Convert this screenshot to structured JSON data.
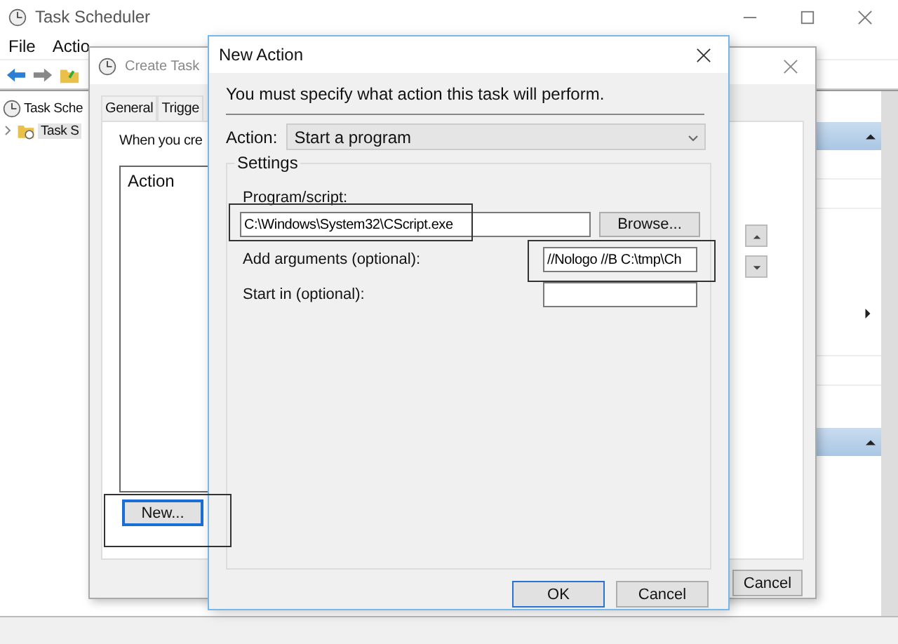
{
  "main_window": {
    "title": "Task Scheduler",
    "menu": [
      "File",
      "Actio"
    ],
    "tree": [
      {
        "label": "Task Sche",
        "expanded": true,
        "children": [
          {
            "label": "Task S",
            "selected": true
          }
        ]
      }
    ]
  },
  "create_task": {
    "title": "Create Task",
    "tabs": [
      {
        "label": "General",
        "selected": false
      },
      {
        "label": "Trigge",
        "selected": false
      }
    ],
    "intro": "When you cre",
    "list_header": "Action",
    "new_button": "New...",
    "cancel_button": "Cancel"
  },
  "new_action": {
    "title": "New Action",
    "instruction": "You must specify what action this task will perform.",
    "action_label": "Action:",
    "action_value": "Start a program",
    "settings_label": "Settings",
    "fields": [
      {
        "kind": "stacked",
        "label": "Program/script:",
        "value": "C:\\Windows\\System32\\CScript.exe"
      },
      {
        "kind": "inline",
        "label": "Add arguments (optional):",
        "value": "//Nologo //B C:\\tmp\\Ch"
      },
      {
        "kind": "inline",
        "label": "Start in (optional):"
      }
    ],
    "browse_button": "Browse...",
    "buttons": [
      "OK",
      "Cancel"
    ]
  }
}
